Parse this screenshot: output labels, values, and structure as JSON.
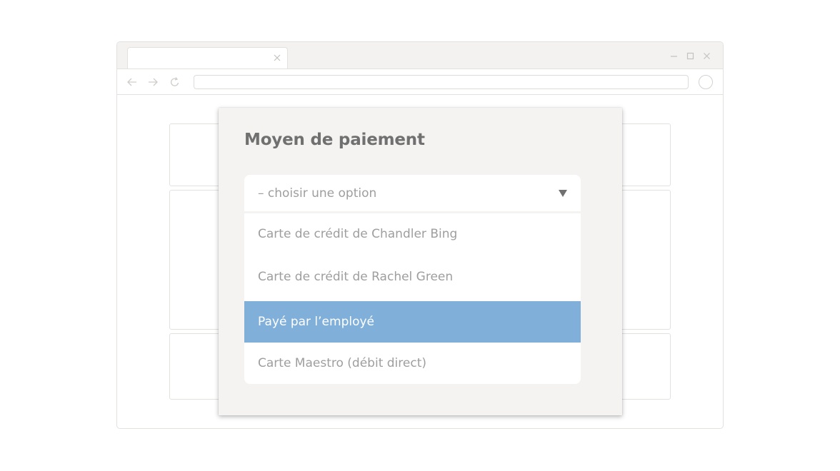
{
  "dialog": {
    "title": "Moyen de paiement",
    "select": {
      "placeholder": "– choisir une option",
      "options": [
        {
          "label": "Carte de crédit de Chandler Bing",
          "selected": false
        },
        {
          "label": "Carte de crédit de Rachel Green",
          "selected": false
        },
        {
          "label": "Payé par l’employé",
          "selected": true
        },
        {
          "label": "Carte Maestro (débit direct)",
          "selected": false
        }
      ]
    }
  },
  "icons": {
    "tab_close": "close-icon",
    "minimize": "minimize-icon",
    "maximize": "maximize-icon",
    "window_close": "close-icon",
    "back": "arrow-left-icon",
    "forward": "arrow-right-icon",
    "reload": "reload-icon",
    "profile": "profile-icon",
    "dropdown": "triangle-down-icon"
  },
  "colors": {
    "highlight": "#80b0da",
    "dialog_bg": "#f4f3f1",
    "text_muted": "#9e9e9e",
    "title": "#707070"
  }
}
